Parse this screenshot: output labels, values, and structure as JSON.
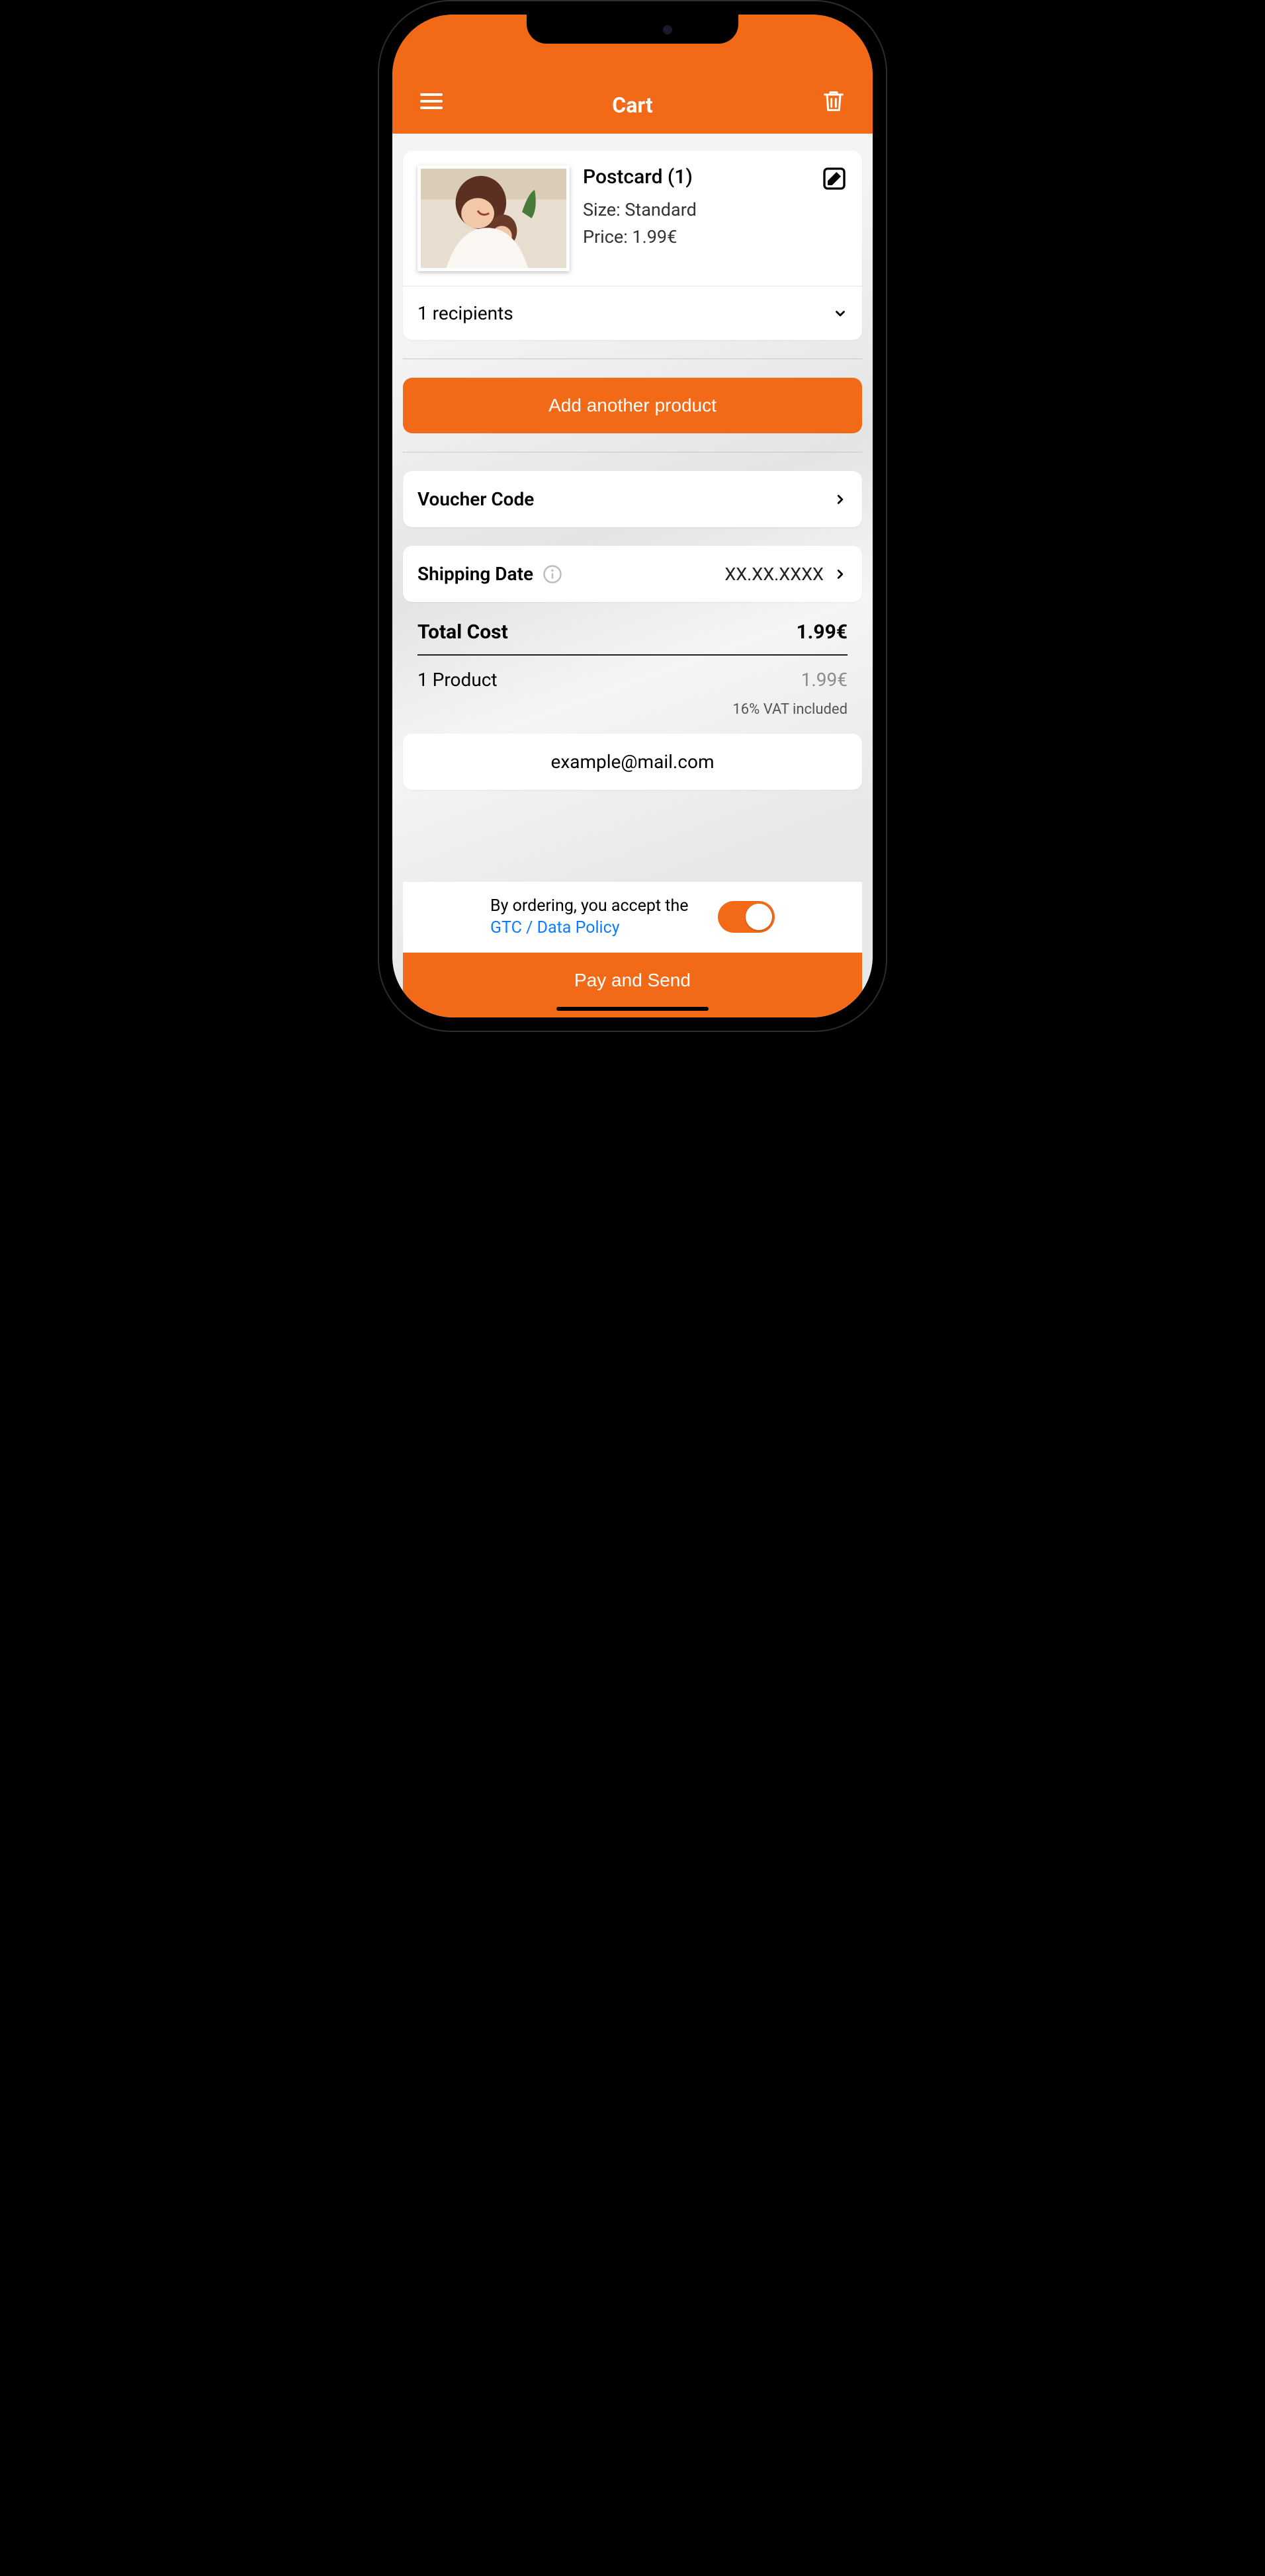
{
  "header": {
    "title": "Cart"
  },
  "product": {
    "title": "Postcard (1)",
    "size_label": "Size: Standard",
    "price_label": "Price: 1.99€",
    "recipients_label": "1 recipients"
  },
  "actions": {
    "add_product": "Add another product"
  },
  "voucher": {
    "label": "Voucher Code"
  },
  "shipping": {
    "label": "Shipping Date",
    "value": "XX.XX.XXXX"
  },
  "totals": {
    "total_label": "Total Cost",
    "total_value": "1.99€",
    "line_label": "1 Product",
    "line_value": "1.99€",
    "vat_note": "16% VAT included"
  },
  "email": {
    "value": "example@mail.com"
  },
  "footer": {
    "accept_prefix": "By ordering, you accept the ",
    "accept_link": "GTC / Data Policy",
    "pay_label": "Pay and Send"
  }
}
